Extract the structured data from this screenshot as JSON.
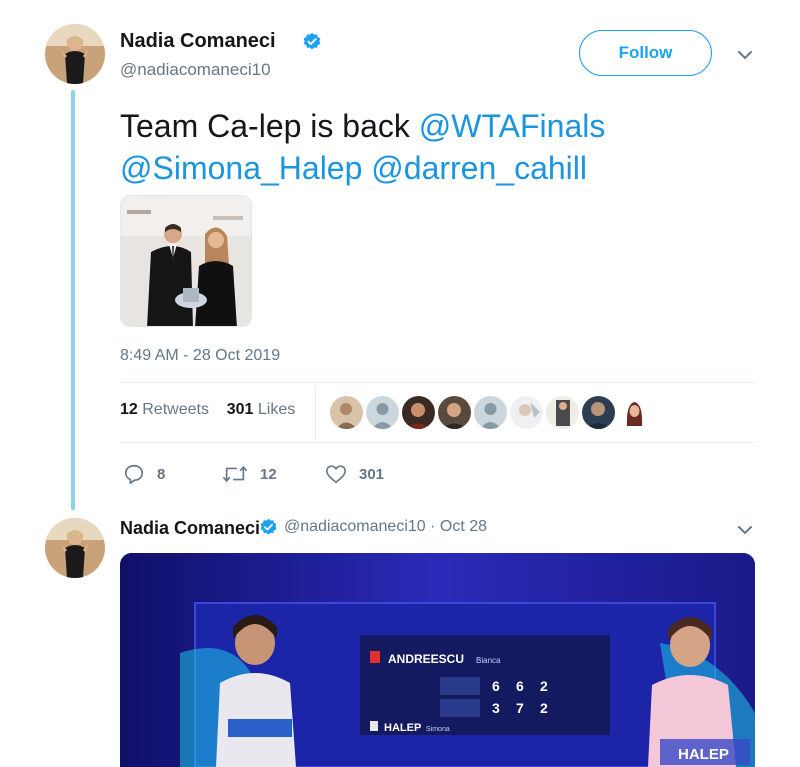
{
  "tweet1": {
    "author_name": "Nadia Comaneci",
    "author_handle": "@nadiacomaneci10",
    "follow_label": "Follow",
    "text_prefix": "Team Ca-lep is back ",
    "mentions": [
      "@WTAFinals",
      "@Simona_Halep",
      "@darren_cahill"
    ],
    "timestamp": "8:49 AM - 28 Oct 2019",
    "retweets_count": "12",
    "retweets_label": "Retweets",
    "likes_count": "301",
    "likes_label": "Likes",
    "actions": {
      "reply_count": "8",
      "retweet_count": "12",
      "like_count": "301"
    },
    "liker_avatar_count": 9
  },
  "tweet2": {
    "author_name": "Nadia Comaneci",
    "author_handle": "@nadiacomaneci10",
    "date": "Oct 28",
    "separator": "·"
  },
  "video": {
    "scoreboard": {
      "player1": "ANDREESCU",
      "player1_first": "Bianca",
      "player2": "HALEP",
      "player2_first": "Simona",
      "p1_sets": [
        "6",
        "6",
        "2"
      ],
      "p2_sets": [
        "3",
        "7",
        "2"
      ]
    },
    "banner_text": "HALEP"
  },
  "colors": {
    "accent": "#1da1f2",
    "mention": "#1b95e0",
    "thread_line": "#8fd0ea",
    "muted": "#657786"
  }
}
